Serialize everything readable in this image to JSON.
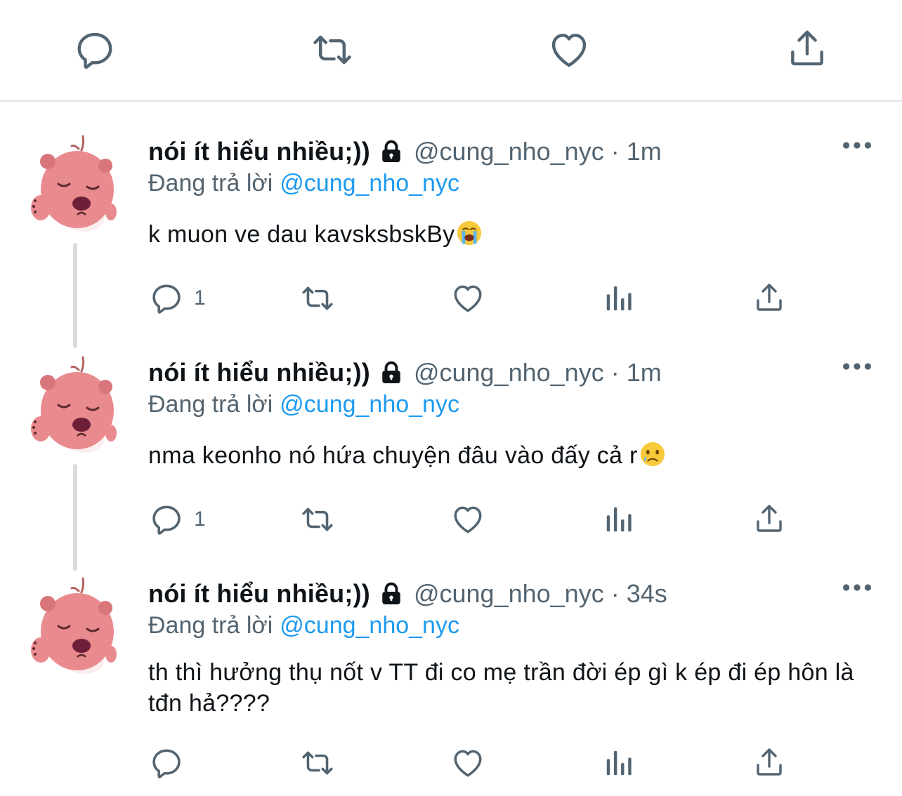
{
  "top_actions": [
    "reply-icon",
    "retweet-icon",
    "like-icon",
    "share-icon"
  ],
  "colors": {
    "text": "#0f1419",
    "secondary": "#536471",
    "link": "#1d9bf0",
    "divider": "#e7e9eb",
    "avatar_pink": "#e98a8f"
  },
  "tweets": [
    {
      "name": "nói ít hiểu nhiều;))",
      "handle": "@cung_nho_nyc",
      "separator": "·",
      "time": "1m",
      "reply_prefix": "Đang trả lời",
      "reply_to": "@cung_nho_nyc",
      "text": "k muon ve dau kavsksbskBy",
      "emoji": "loudly-crying-face",
      "reply_count": "1"
    },
    {
      "name": "nói ít hiểu nhiều;))",
      "handle": "@cung_nho_nyc",
      "separator": "·",
      "time": "1m",
      "reply_prefix": "Đang trả lời",
      "reply_to": "@cung_nho_nyc",
      "text": "nma keonho nó hứa chuyện đâu vào đấy cả r",
      "emoji": "crying-face",
      "reply_count": "1"
    },
    {
      "name": "nói ít hiểu nhiều;))",
      "handle": "@cung_nho_nyc",
      "separator": "·",
      "time": "34s",
      "reply_prefix": "Đang trả lời",
      "reply_to": "@cung_nho_nyc",
      "text": "th thì hưởng thụ nốt v TT đi co mẹ trần đời ép gì k ép đi ép hôn là tđn hả????",
      "reply_count": ""
    }
  ]
}
